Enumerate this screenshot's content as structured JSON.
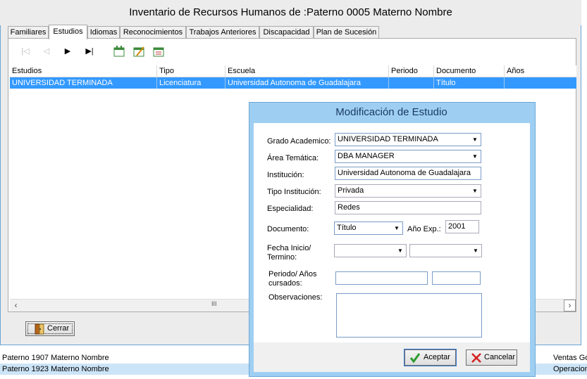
{
  "background_list": {
    "rows": [
      {
        "name": "Paterno 1907 Materno  Nombre",
        "dept": "Ventas Go",
        "selected": false
      },
      {
        "name": "Paterno 1923 Materno  Nombre",
        "dept": "Operacion",
        "selected": true
      }
    ]
  },
  "window": {
    "title": "Inventario de Recursos Humanos de :Paterno 0005 Materno  Nombre",
    "tabs": [
      {
        "label": "Familiares",
        "active": false
      },
      {
        "label": "Estudios",
        "active": true
      },
      {
        "label": "Idiomas",
        "active": false
      },
      {
        "label": "Reconocimientos",
        "active": false
      },
      {
        "label": "Trabajos Anteriores",
        "active": false
      },
      {
        "label": "Discapacidad",
        "active": false
      },
      {
        "label": "Plan de Sucesión",
        "active": false
      }
    ],
    "toolbar": {
      "first_glyph": "|◁",
      "prev_glyph": "◁",
      "next_glyph": "▶",
      "last_glyph": "▶|"
    },
    "grid": {
      "columns": [
        "Estudios",
        "Tipo",
        "Escuela",
        "Periodo",
        "Documento",
        "Años"
      ],
      "rows": [
        [
          "UNIVERSIDAD TERMINADA",
          "Licenciatura",
          "Universidad Autonoma de Guadalajara",
          "",
          "Título",
          ""
        ]
      ]
    },
    "scroll_thumb_glyph": "III",
    "close_button": "Cerrar"
  },
  "dialog": {
    "title": "Modificación de Estudio",
    "fields": {
      "grado_label": "Grado Academico:",
      "grado_value": "UNIVERSIDAD TERMINADA",
      "area_label": "Área Temática:",
      "area_value": "DBA MANAGER",
      "institucion_label": "Institución:",
      "institucion_value": "Universidad Autonoma de Guadalajara",
      "tipo_inst_label": "Tipo Institución:",
      "tipo_inst_value": "Privada",
      "especialidad_label": "Especialidad:",
      "especialidad_value": "Redes",
      "documento_label": "Documento:",
      "documento_value": "Título",
      "anio_exp_label": "Año Exp.:",
      "anio_exp_value": "2001",
      "fecha_label_1": "Fecha Inicio/",
      "fecha_label_2": "Termino:",
      "periodo_label_1": "Periodo/ Años",
      "periodo_label_2": "cursados:",
      "observaciones_label": "Observaciones:"
    },
    "accept_button": "Aceptar",
    "cancel_button": "Cancelar"
  },
  "colors": {
    "selection": "#3399ff",
    "dialog_frame": "#9ecff2",
    "accept_check": "#2e9b2e",
    "cancel_x": "#d42020"
  }
}
